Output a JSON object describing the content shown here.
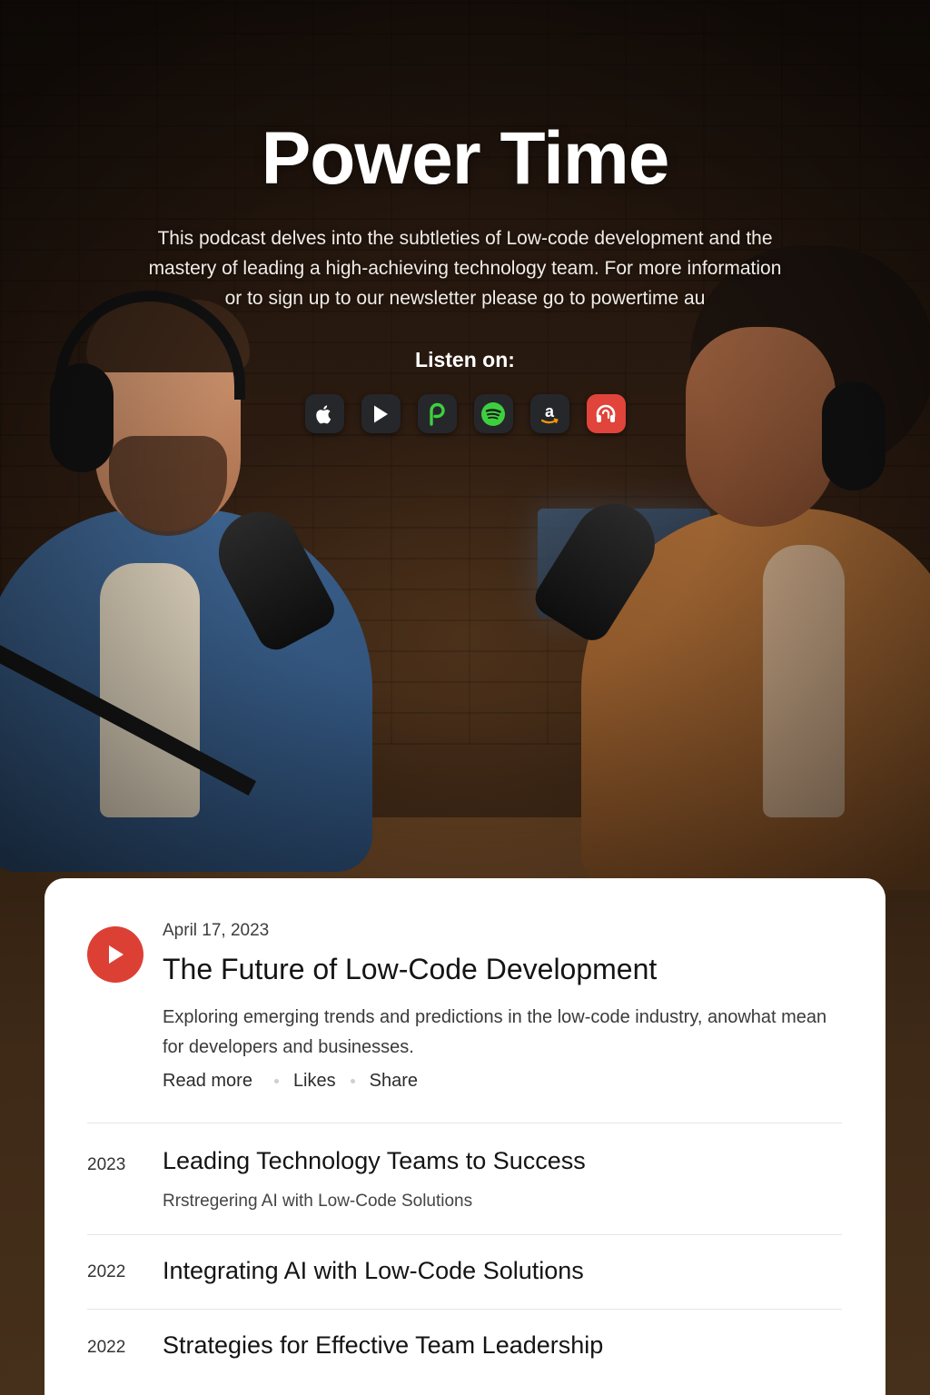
{
  "hero": {
    "title": "Power Time",
    "description": "This podcast delves into the subtleties of Low-code development and the mastery of leading a high-achieving technology team. For more information or to sign up to our newsletter please go to powertime au",
    "listen_label": "Listen on:",
    "platforms": [
      {
        "name": "apple-podcasts",
        "icon": "apple-icon",
        "color": "#25272b"
      },
      {
        "name": "youtube",
        "icon": "play-icon",
        "color": "#25272b"
      },
      {
        "name": "pocket-casts",
        "icon": "p-icon",
        "color": "#25272b",
        "accent": "#3ecf3e"
      },
      {
        "name": "spotify",
        "icon": "spotify-icon",
        "color": "#25272b",
        "accent": "#3ecf3e"
      },
      {
        "name": "amazon-music",
        "icon": "amazon-icon",
        "color": "#25272b",
        "accent": "#ff9900"
      },
      {
        "name": "podcast-addict",
        "icon": "headphones-icon",
        "color": "#e0443a"
      }
    ]
  },
  "featured": {
    "date": "April 17, 2023",
    "title": "The Future of Low-Code Development",
    "description": "Exploring emerging trends and predictions in the low-code industry, anowhat mean for developers and businesses.",
    "actions": [
      "Read more",
      "Likes",
      "Share"
    ],
    "play_color": "#dc4034"
  },
  "episodes": [
    {
      "year": "2023",
      "title": "Leading Technology Teams to Success",
      "subtitle": "Rrstregering AI with Low-Code Solutions"
    },
    {
      "year": "2022",
      "title": "Integrating AI with Low-Code Solutions",
      "subtitle": ""
    },
    {
      "year": "2022",
      "title": "Strategies for Effective Team Leadership",
      "subtitle": ""
    }
  ]
}
